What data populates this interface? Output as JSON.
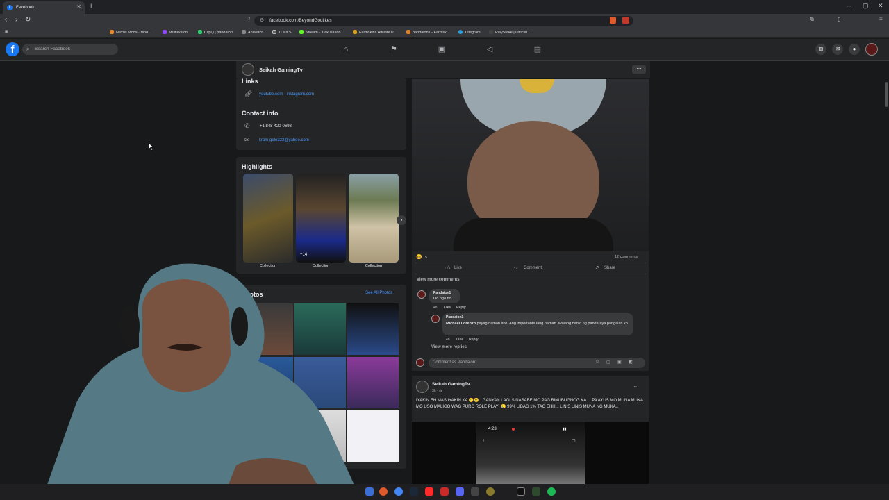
{
  "browser": {
    "tab_title": "Facebook",
    "url": "facebook.com/BeyondGodlikes",
    "bookmarks": [
      "Nexus Mods · Mod...",
      "MultiWatch",
      "ClipQ | pandaion",
      "Aniwatch",
      "TOOLS",
      "Stream - Kick Dashb...",
      "Farmskins Affiliate P...",
      "pandaion1 - Farmsk...",
      "Telegram",
      "PlayStake | Official..."
    ]
  },
  "facebook": {
    "search_placeholder": "Search Facebook",
    "profile_name": "Seikah GamingTv",
    "links_heading": "Links",
    "links_value": "youtube.com · instagram.com",
    "contact_heading": "Contact info",
    "phone": "+1 848-420-0698",
    "email": "kram.gelo322@yahoo.com",
    "highlights_heading": "Highlights",
    "highlights": [
      {
        "label": "Collection",
        "badge": ""
      },
      {
        "label": "Collection",
        "badge": "+14"
      },
      {
        "label": "Collection",
        "badge": ""
      }
    ],
    "photos_heading": "Photos",
    "see_all_photos": "See All Photos"
  },
  "post1": {
    "reaction_count": "5",
    "comments_count": "12 comments",
    "like_label": "Like",
    "comment_label": "Comment",
    "share_label": "Share",
    "view_more_comments": "View more comments",
    "comments": [
      {
        "author": "Pandaion1",
        "text": "Oo nga no",
        "time": "4h",
        "like": "Like",
        "reply": "Reply"
      },
      {
        "author": "Pandaion1",
        "mention": "Michael Lorenzo",
        "text": "payag naman ako. Ang importante lang naman. Walang bahid ng pandaraya pangalan ko",
        "time": "4h",
        "like": "Like",
        "reply": "Reply"
      }
    ],
    "view_more_replies": "View more replies",
    "comment_placeholder": "Comment as Pandaion1"
  },
  "post2": {
    "author": "Seikah GamingTv",
    "time": "3h · ",
    "text": "IYAKIN EH MAS IYAKIN KA 🥲🥲 . GANYAN LAGI SINASABE MO PAG BINUBUGNOG KA ... PA AYUS MO MUNA MUKA MO USO MALIGO WAG PURO ROLE PLAY! 🥲 99% LIBAG 1% TAO EHH .. LINIS LINIS MUNA NG MUKA..",
    "phone_time": "4:23"
  },
  "colors": {
    "fb_blue": "#1877f2",
    "link": "#4599ff",
    "bg": "#18191a",
    "card": "#242526"
  }
}
